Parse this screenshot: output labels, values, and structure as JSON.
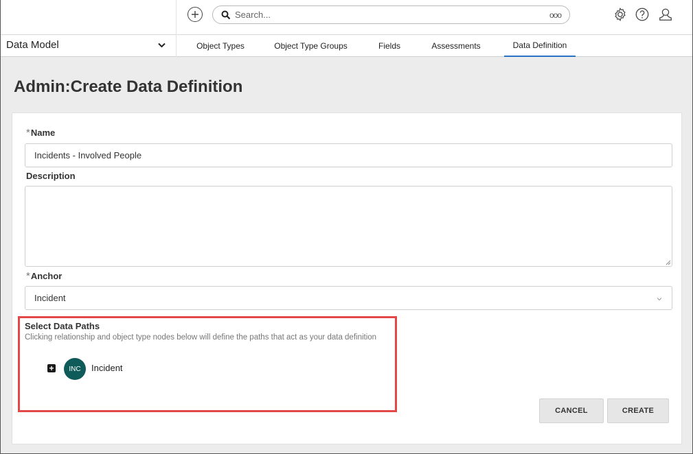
{
  "header": {
    "search_placeholder": "Search...",
    "search_more": "ooo",
    "icons": [
      "add-icon",
      "search-icon",
      "gear-icon",
      "help-icon",
      "user-icon"
    ]
  },
  "nav": {
    "model_label": "Data Model",
    "tabs": [
      {
        "label": "Object Types",
        "active": false
      },
      {
        "label": "Object Type Groups",
        "active": false
      },
      {
        "label": "Fields",
        "active": false
      },
      {
        "label": "Assessments",
        "active": false
      },
      {
        "label": "Data Definition",
        "active": true
      }
    ]
  },
  "page": {
    "title": "Admin:Create Data Definition"
  },
  "form": {
    "required_mark": "*",
    "name_label": "Name",
    "name_value": "Incidents - Involved People",
    "description_label": "Description",
    "description_value": "",
    "anchor_label": "Anchor",
    "anchor_value": "Incident",
    "paths_title": "Select Data Paths",
    "paths_description": "Clicking relationship and object type nodes below will define the paths that act as your data definition",
    "node": {
      "abbr": "INC",
      "label": "Incident",
      "expand_symbol": "+"
    },
    "cancel_label": "CANCEL",
    "create_label": "CREATE"
  },
  "colors": {
    "accent": "#2872c3",
    "node": "#0e5b5a",
    "highlight": "#e24848"
  }
}
